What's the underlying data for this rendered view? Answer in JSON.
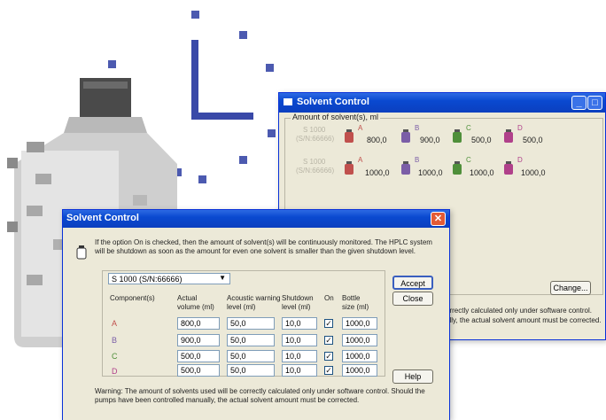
{
  "back_window": {
    "title": "Solvent Control",
    "group_label": "Amount of solvent(s), ml",
    "rows": [
      {
        "device_name": "S 1000",
        "device_serial": "(S/N:66666)",
        "items": [
          {
            "letter": "A",
            "value": "800,0"
          },
          {
            "letter": "B",
            "value": "900,0"
          },
          {
            "letter": "C",
            "value": "500,0"
          },
          {
            "letter": "D",
            "value": "500,0"
          }
        ]
      },
      {
        "device_name": "S 1000",
        "device_serial": "(S/N:66666)",
        "items": [
          {
            "letter": "A",
            "value": "1000,0"
          },
          {
            "letter": "B",
            "value": "1000,0"
          },
          {
            "letter": "C",
            "value": "1000,0"
          },
          {
            "letter": "D",
            "value": "1000,0"
          }
        ]
      }
    ],
    "change_button": "Change...",
    "warning_fragment_1": "orrectly calculated only under software control.",
    "warning_fragment_2": "ally, the actual solvent amount must be corrected."
  },
  "front_window": {
    "title": "Solvent Control",
    "info_text_1": "If the option On is checked, then the amount of solvent(s) will be continuously monitored. The HPLC system",
    "info_text_2": "will be shutdown as soon as the amount for even one solvent is smaller than the given shutdown level.",
    "device_select": "S 1000 (S/N:66666)",
    "headers": {
      "component": "Component(s)",
      "actual_1": "Actual",
      "actual_2": "volume (ml)",
      "warning_1": "Acoustic warning",
      "warning_2": "level (ml)",
      "shutdown_1": "Shutdown",
      "shutdown_2": "level (ml)",
      "on": "On",
      "bottle_1": "Bottle",
      "bottle_2": "size (ml)"
    },
    "rows": [
      {
        "letter": "A",
        "actual": "800,0",
        "warning": "50,0",
        "shutdown": "10,0",
        "on": "✓",
        "bottle": "1000,0"
      },
      {
        "letter": "B",
        "actual": "900,0",
        "warning": "50,0",
        "shutdown": "10,0",
        "on": "✓",
        "bottle": "1000,0"
      },
      {
        "letter": "C",
        "actual": "500,0",
        "warning": "50,0",
        "shutdown": "10,0",
        "on": "✓",
        "bottle": "1000,0"
      },
      {
        "letter": "D",
        "actual": "500,0",
        "warning": "50,0",
        "shutdown": "10,0",
        "on": "✓",
        "bottle": "1000,0"
      }
    ],
    "accept_button": "Accept",
    "close_button": "Close",
    "help_button": "Help",
    "warning_text_1": "Warning: The amount of solvents used will be correctly calculated only under software control. Should the",
    "warning_text_2": "pumps have been  controlled manually, the actual solvent amount must be corrected."
  },
  "colors": {
    "title_bar": "#0b3fbf",
    "letter_a": "#c0504d",
    "letter_b": "#7b5ea7",
    "letter_c": "#4f8f3a",
    "letter_d": "#b0408a"
  }
}
